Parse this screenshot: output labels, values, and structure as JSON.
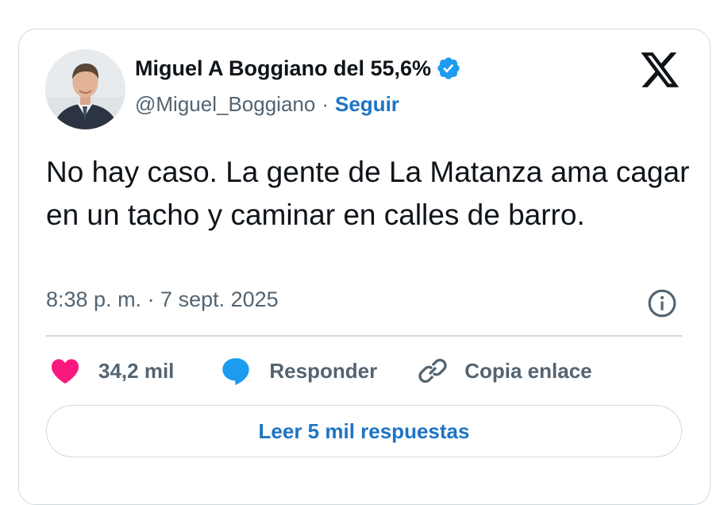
{
  "author": {
    "display_name": "Miguel A Boggiano del 55,6%",
    "handle": "@Miguel_Boggiano",
    "separator": "·",
    "follow_label": "Seguir",
    "verified": true,
    "verified_icon": "verified-badge-icon",
    "avatar": "profile-photo"
  },
  "brand": {
    "logo": "x-logo-icon"
  },
  "tweet": {
    "text": "No hay caso. La gente de La Matanza ama cagar en un tacho y caminar en calles de barro.",
    "timestamp": "8:38 p. m. · 7 sept. 2025",
    "info_icon": "info-icon"
  },
  "actions": {
    "like_count": "34,2 mil",
    "reply_label": "Responder",
    "copy_label": "Copia enlace"
  },
  "replies_button": {
    "label": "Leer 5 mil respuestas"
  },
  "colors": {
    "accent": "#1d74c4",
    "like": "#f91880",
    "verified": "#1d9bf0",
    "secondary_text": "#536471",
    "border": "#cfd9de"
  }
}
